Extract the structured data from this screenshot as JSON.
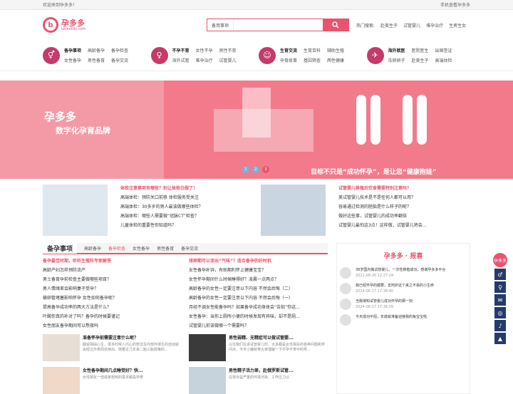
{
  "top": {
    "welcome": "欢迎来到孕多多！",
    "mobile": "手机查看孕多多"
  },
  "logo": {
    "name": "孕多多",
    "sub": "tecentdo.com"
  },
  "search": {
    "category": "备用事项",
    "placeholder": ""
  },
  "hot": {
    "label": "热门搜索:",
    "items": [
      "赴美生子",
      "试管婴儿",
      "难孕治疗",
      "生男生女"
    ]
  },
  "cats": [
    {
      "icon": "⚥",
      "items": [
        "备孕事项",
        "高龄备孕",
        "备孕检查",
        "女性备孕",
        "男性备育",
        "备孕交流"
      ]
    },
    {
      "icon": "♀",
      "items": [
        "不孕不育",
        "女性不孕",
        "男性不育",
        "海外试管",
        "难孕治疗",
        "试管婴儿"
      ]
    },
    {
      "icon": "☺",
      "items": [
        "生育交流",
        "生育百科",
        "辅助生殖",
        "孕育故事",
        "基因筛查",
        "两性健康"
      ]
    },
    {
      "icon": "✈",
      "items": [
        "海外就医",
        "医院医生",
        "出国签证",
        "冻卵卵子",
        "赴美生子",
        "高端体检"
      ]
    }
  ],
  "banner": {
    "brand": "孕多多",
    "sub": "数字化孕育品牌",
    "slogan": "目标不只是“成功怀孕”，是让您“健康抱娃”",
    "dots": [
      "1",
      "2",
      "3"
    ]
  },
  "news_left": [
    "体检注意事项有哪些？别让体检白做了！",
    "高端体检：预防关口前移 体检服务受关注",
    "高端体检：30多岁的男人最该做哪些体检？",
    "高端体检：哪些人需要做“冠脉CT”检查？",
    "儿童体检的重要性你知道吗？"
  ],
  "news_right": [
    "试管婴儿移植后饮食需要特别注意吗？",
    "美试管婴儿技术是不是任何人都可以用？",
    "容易通过检测的胚胎是什么样子的呢？",
    "做好这些事，试管婴儿的成功率翻倍",
    "试管婴儿最怕这3点！这样做，试管婴儿将会..."
  ],
  "tabs": {
    "main": "备孕事项",
    "items": [
      "高龄备孕",
      "备孕检查",
      "女性备孕",
      "男性备育",
      "备孕交流"
    ]
  },
  "col1": [
    "备孕最佳时期，听听生殖科专家解答",
    "高龄产妇怎样预防流产",
    "男士备育孕前检查主要做哪些项目？",
    "男人情绪差会影响妻子受孕？",
    "输卵管堵塞影响怀孕 女性如何备孕呢？",
    "提高备孕成功率的两大方法是什么？",
    "叶酸你真的补对了吗？备孕的时候要谨记",
    "女性朋友备孕期间可以熬夜吗"
  ],
  "col2": [
    "排卵期可以泥出“气味”？适合备孕的好时机",
    "女性备孕补锌，有助期利怀上健康宝宝？",
    "女性怀孕期间什么时候睡得好？凌晨一点两点？",
    "高龄备孕的女性一定要注意以下内容 不然会后悔（二）",
    "高龄备孕的女性一定要注意以下内容 不然会后悔（一）",
    "月经不调女性能备孕吗？如果备孕成功身体会“告知”你这...",
    "女性备孕：当你上厕所小便的时候发现有异味，却不是厕...",
    "试管婴儿前该做哪一个需要吗？"
  ],
  "cards": [
    {
      "title": "准备怀孕前需要注意什么呢？",
      "txt": "都说相由心生，很多时候人内心的想法及内部环境生的自动就会经过外表而反映出。随着近几年来二胎三胎政策的..."
    },
    {
      "title": "男性弱精、无精症可以做试管婴...",
      "txt": "以往我们在讲试管婴儿时，大多都是女性相关的各种问题和学问点，今天小编就带大家理解一下不孕不育中的男..."
    },
    {
      "title": "女性备孕期间几点睡觉好？快...",
      "txt": "女性朋友一但成家想到的基本都是孕育"
    },
    {
      "title": "男性精子活力差，赴俄罗斯试管...",
      "txt": "在常日益严重的环境污染、工作压力以"
    }
  ],
  "report": {
    "title": "孕多多 · 报喜",
    "items": [
      {
        "txt": "38岁国内做试管婴儿，一次性移植成功，感谢孕多多平台",
        "date": "2021-08-26 12:27:24"
      },
      {
        "txt": "我已经怀孕的都要，去阿护这个来之不易的小生命",
        "date": "2024-06-17 17:38:40"
      },
      {
        "txt": "当我得知试管婴儿成功怀孕的那一刻",
        "date": "2024-06-17 17:36:09"
      },
      {
        "txt": "今天成功中招，年底就准备迎接我的兔宝宝啦",
        "date": ""
      }
    ]
  },
  "float": {
    "label": "孕多多",
    "icons": [
      "♂",
      "♀",
      "✉",
      "◎",
      "♪",
      "▲"
    ]
  }
}
